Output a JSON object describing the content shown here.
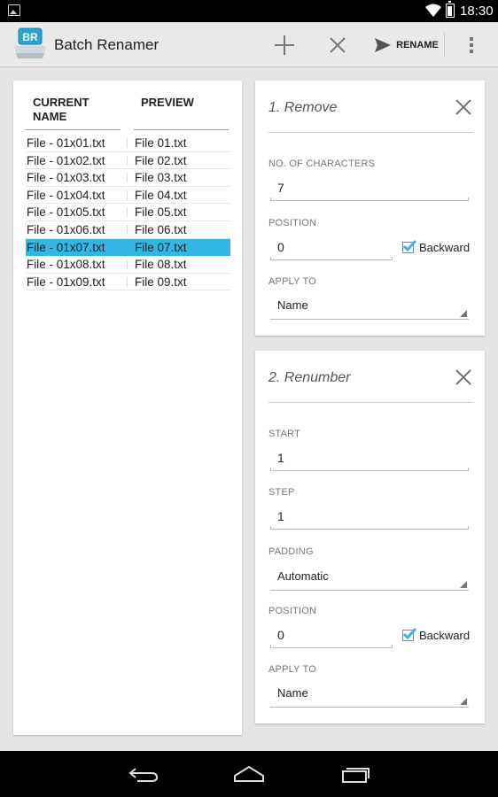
{
  "status_bar": {
    "time": "18:30",
    "icons": [
      "image-notification-icon",
      "wifi-icon",
      "battery-icon"
    ]
  },
  "app": {
    "title": "Batch Renamer",
    "logo_text": "BR",
    "actions": {
      "add": "add-icon",
      "close": "close-icon",
      "rename_label": "RENAME",
      "overflow": "overflow-menu-icon"
    }
  },
  "file_table": {
    "headers": {
      "current": "CURRENT NAME",
      "preview": "PREVIEW"
    },
    "rows": [
      {
        "current": "File - 01x01.txt",
        "preview": "File 01.txt",
        "selected": false
      },
      {
        "current": "File - 01x02.txt",
        "preview": "File 02.txt",
        "selected": false
      },
      {
        "current": "File - 01x03.txt",
        "preview": "File 03.txt",
        "selected": false
      },
      {
        "current": "File - 01x04.txt",
        "preview": "File 04.txt",
        "selected": false
      },
      {
        "current": "File - 01x05.txt",
        "preview": "File 05.txt",
        "selected": false
      },
      {
        "current": "File - 01x06.txt",
        "preview": "File 06.txt",
        "selected": false
      },
      {
        "current": "File - 01x07.txt",
        "preview": "File 07.txt",
        "selected": true
      },
      {
        "current": "File - 01x08.txt",
        "preview": "File 08.txt",
        "selected": false
      },
      {
        "current": "File - 01x09.txt",
        "preview": "File 09.txt",
        "selected": false
      }
    ]
  },
  "operations": {
    "remove": {
      "title": "1. Remove",
      "chars_label": "NO. OF CHARACTERS",
      "chars_value": "7",
      "position_label": "POSITION",
      "position_value": "0",
      "backward_label": "Backward",
      "backward_checked": true,
      "apply_label": "APPLY TO",
      "apply_value": "Name"
    },
    "renumber": {
      "title": "2. Renumber",
      "start_label": "START",
      "start_value": "1",
      "step_label": "STEP",
      "step_value": "1",
      "padding_label": "PADDING",
      "padding_value": "Automatic",
      "position_label": "POSITION",
      "position_value": "0",
      "backward_label": "Backward",
      "backward_checked": true,
      "apply_label": "APPLY TO",
      "apply_value": "Name"
    }
  },
  "colors": {
    "selection": "#33b5e5",
    "checkbox": "#33b5e5",
    "background": "#e4e4e4"
  },
  "nav_bar": {
    "buttons": [
      "back-icon",
      "home-icon",
      "recents-icon"
    ]
  }
}
